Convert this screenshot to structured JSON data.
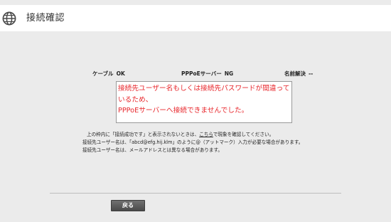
{
  "header": {
    "title": "接続確認",
    "icon": "globe-icon"
  },
  "status": {
    "cable_label": "ケーブル",
    "cable_value": "OK",
    "pppoe_label": "PPPoEサーバー",
    "pppoe_value": "NG",
    "name_label": "名前解決",
    "name_value": "--"
  },
  "message": {
    "line1": "接続先ユーザー名もしくは接続先パスワードが間違っているため、",
    "line2": "PPPoEサーバーへ接続できませんでした。",
    "color": "#e8262b"
  },
  "notes": {
    "line1_pre": "上の枠内に「接続成功です」と表示されないときは、",
    "line1_link": "こちら",
    "line1_post": "で現象を確認してください。",
    "line2": "接続先ユーザー名は、「abcd@efg.hij.klm」のように@（アットマーク）入力が必要な場合があります。",
    "line3": "接続先ユーザー名は、メールアドレスとは異なる場合があります。"
  },
  "buttons": {
    "back_label": "戻る"
  }
}
